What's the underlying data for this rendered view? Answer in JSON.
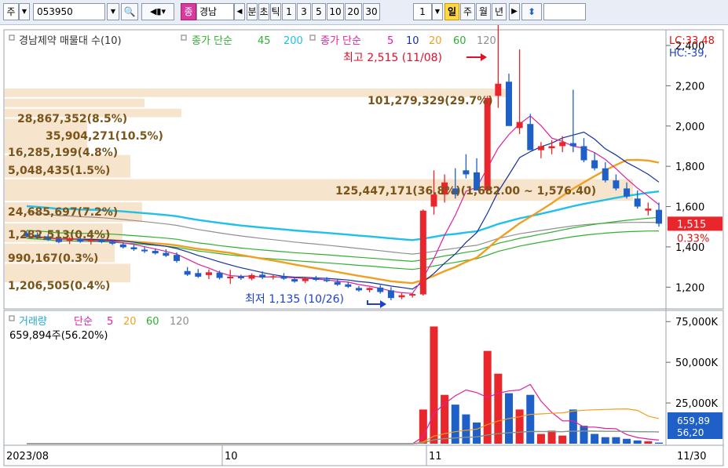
{
  "toolbar": {
    "market": "주",
    "code": "053950",
    "name": "경남",
    "name_badge": "종",
    "periods": [
      "분",
      "초",
      "틱",
      "1",
      "3",
      "5",
      "10",
      "20",
      "30"
    ],
    "count": "1",
    "views": [
      "일",
      "주",
      "월",
      "년"
    ],
    "selected_view": "일"
  },
  "colors": {
    "up": "#e8262b",
    "down": "#1e5fc8",
    "ma5": "#e020a0",
    "ma10": "#1530a0",
    "ma20": "#f0a020",
    "ma60": "#30b030",
    "ma120": "#909090",
    "ma45": "#30b030",
    "ma200": "#20c0ea",
    "volume_band": "#f5e1c8"
  },
  "legend": {
    "title": "경남제약 매물대 수(10)",
    "ma_a_label": "종가 단순",
    "ma_a_periods": [
      "45",
      "200"
    ],
    "ma_b_label": "종가 단순",
    "ma_b_periods": [
      "5",
      "10",
      "20",
      "60",
      "120"
    ],
    "lc": "LC:33,48",
    "hc": "HC:-39,"
  },
  "annotations": {
    "high": "최고 2,515 (11/08)",
    "low": "최저 1,135 (10/26)"
  },
  "volume_profile": [
    {
      "label": "101,279,329(29.7%)"
    },
    {
      "label": "28,867,352(8.5%)"
    },
    {
      "label": "35,904,271(10.5%)"
    },
    {
      "label": "16,285,199(4.8%)"
    },
    {
      "label": "5,048,435(1.5%)"
    },
    {
      "label": "125,447,171(36.8%)(1,682.00 ~ 1,576.40)"
    },
    {
      "label": "24,685,697(7.2%)"
    },
    {
      "label": "1,282,513(0.4%)"
    },
    {
      "label": "990,167(0.3%)"
    },
    {
      "label": "1,206,505(0.4%)"
    }
  ],
  "price_axis": {
    "ticks": [
      "2,400",
      "2,200",
      "2,000",
      "1,800",
      "1,600",
      "1,400",
      "1,200"
    ],
    "current": "1,515",
    "change": "0.33%"
  },
  "volume_panel": {
    "title": "거래량",
    "ma_label": "단순",
    "ma_periods": [
      "5",
      "20",
      "60",
      "120"
    ],
    "info": "659,894주(56.20%)",
    "ticks": [
      "75,000K",
      "50,000K",
      "25,000K"
    ],
    "current": "659,89",
    "current_pct": "56,20"
  },
  "date_axis": {
    "labels": [
      "2023/08",
      "10",
      "11",
      "11/30"
    ]
  },
  "chart_data": {
    "type": "candlestick",
    "price_ylim": [
      1100,
      2470
    ],
    "volume_ylim": [
      0,
      78000000
    ],
    "candles": [
      {
        "o": 1468,
        "h": 1480,
        "l": 1448,
        "c": 1452
      },
      {
        "o": 1460,
        "h": 1472,
        "l": 1440,
        "c": 1446
      },
      {
        "o": 1452,
        "h": 1462,
        "l": 1430,
        "c": 1436
      },
      {
        "o": 1438,
        "h": 1452,
        "l": 1418,
        "c": 1424
      },
      {
        "o": 1430,
        "h": 1448,
        "l": 1414,
        "c": 1440
      },
      {
        "o": 1440,
        "h": 1450,
        "l": 1420,
        "c": 1426
      },
      {
        "o": 1428,
        "h": 1442,
        "l": 1412,
        "c": 1434
      },
      {
        "o": 1434,
        "h": 1440,
        "l": 1418,
        "c": 1424
      },
      {
        "o": 1426,
        "h": 1434,
        "l": 1410,
        "c": 1416
      },
      {
        "o": 1412,
        "h": 1424,
        "l": 1392,
        "c": 1398
      },
      {
        "o": 1398,
        "h": 1410,
        "l": 1380,
        "c": 1388
      },
      {
        "o": 1386,
        "h": 1400,
        "l": 1370,
        "c": 1378
      },
      {
        "o": 1380,
        "h": 1392,
        "l": 1362,
        "c": 1368
      },
      {
        "o": 1370,
        "h": 1388,
        "l": 1350,
        "c": 1356
      },
      {
        "o": 1360,
        "h": 1372,
        "l": 1322,
        "c": 1330
      },
      {
        "o": 1280,
        "h": 1300,
        "l": 1256,
        "c": 1262
      },
      {
        "o": 1270,
        "h": 1290,
        "l": 1246,
        "c": 1252
      },
      {
        "o": 1260,
        "h": 1288,
        "l": 1240,
        "c": 1274
      },
      {
        "o": 1272,
        "h": 1282,
        "l": 1238,
        "c": 1246
      },
      {
        "o": 1244,
        "h": 1286,
        "l": 1216,
        "c": 1252
      },
      {
        "o": 1254,
        "h": 1262,
        "l": 1236,
        "c": 1244
      },
      {
        "o": 1242,
        "h": 1268,
        "l": 1234,
        "c": 1260
      },
      {
        "o": 1262,
        "h": 1278,
        "l": 1240,
        "c": 1248
      },
      {
        "o": 1250,
        "h": 1262,
        "l": 1238,
        "c": 1254
      },
      {
        "o": 1252,
        "h": 1270,
        "l": 1236,
        "c": 1242
      },
      {
        "o": 1240,
        "h": 1250,
        "l": 1222,
        "c": 1228
      },
      {
        "o": 1230,
        "h": 1250,
        "l": 1220,
        "c": 1244
      },
      {
        "o": 1244,
        "h": 1256,
        "l": 1230,
        "c": 1236
      },
      {
        "o": 1238,
        "h": 1250,
        "l": 1224,
        "c": 1230
      },
      {
        "o": 1226,
        "h": 1238,
        "l": 1206,
        "c": 1212
      },
      {
        "o": 1214,
        "h": 1228,
        "l": 1196,
        "c": 1202
      },
      {
        "o": 1196,
        "h": 1206,
        "l": 1178,
        "c": 1184
      },
      {
        "o": 1186,
        "h": 1200,
        "l": 1174,
        "c": 1196
      },
      {
        "o": 1198,
        "h": 1210,
        "l": 1168,
        "c": 1176
      },
      {
        "o": 1184,
        "h": 1200,
        "l": 1135,
        "c": 1146
      },
      {
        "o": 1150,
        "h": 1170,
        "l": 1140,
        "c": 1160
      },
      {
        "o": 1158,
        "h": 1170,
        "l": 1148,
        "c": 1166
      },
      {
        "o": 1164,
        "h": 1586,
        "l": 1158,
        "c": 1580
      },
      {
        "o": 1600,
        "h": 1780,
        "l": 1560,
        "c": 1660
      },
      {
        "o": 1660,
        "h": 1760,
        "l": 1620,
        "c": 1720
      },
      {
        "o": 1690,
        "h": 1790,
        "l": 1640,
        "c": 1660
      },
      {
        "o": 1780,
        "h": 1860,
        "l": 1740,
        "c": 1760
      },
      {
        "o": 1770,
        "h": 1840,
        "l": 1700,
        "c": 1680
      },
      {
        "o": 1680,
        "h": 2150,
        "l": 1670,
        "c": 2140
      },
      {
        "o": 2150,
        "h": 2515,
        "l": 2090,
        "c": 2210
      },
      {
        "o": 2220,
        "h": 2260,
        "l": 2140,
        "c": 2000
      },
      {
        "o": 1990,
        "h": 2380,
        "l": 1960,
        "c": 2020
      },
      {
        "o": 2010,
        "h": 2060,
        "l": 1900,
        "c": 1880
      },
      {
        "o": 1880,
        "h": 1920,
        "l": 1840,
        "c": 1900
      },
      {
        "o": 1890,
        "h": 1930,
        "l": 1860,
        "c": 1900
      },
      {
        "o": 1900,
        "h": 1950,
        "l": 1870,
        "c": 1920
      },
      {
        "o": 1915,
        "h": 2180,
        "l": 1870,
        "c": 1900
      },
      {
        "o": 1900,
        "h": 1940,
        "l": 1820,
        "c": 1830
      },
      {
        "o": 1830,
        "h": 1870,
        "l": 1780,
        "c": 1790
      },
      {
        "o": 1790,
        "h": 1820,
        "l": 1720,
        "c": 1730
      },
      {
        "o": 1730,
        "h": 1760,
        "l": 1680,
        "c": 1690
      },
      {
        "o": 1690,
        "h": 1720,
        "l": 1640,
        "c": 1650
      },
      {
        "o": 1640,
        "h": 1680,
        "l": 1590,
        "c": 1600
      },
      {
        "o": 1580,
        "h": 1620,
        "l": 1556,
        "c": 1590
      },
      {
        "o": 1584,
        "h": 1620,
        "l": 1500,
        "c": 1515
      }
    ],
    "volume": [
      0,
      0,
      0,
      0,
      0,
      0,
      0,
      0,
      0,
      0,
      0,
      0,
      0,
      0,
      0,
      0,
      0,
      0,
      0,
      0,
      0,
      0,
      0,
      0,
      0,
      0,
      0,
      0,
      0,
      0,
      0,
      0,
      0,
      0,
      0,
      0,
      0,
      21000000,
      72000000,
      30000000,
      24000000,
      18000000,
      13000000,
      57000000,
      43000000,
      31000000,
      21000000,
      30000000,
      6000000,
      8000000,
      5000000,
      21000000,
      11000000,
      6000000,
      4000000,
      4000000,
      3000000,
      2000000,
      1500000,
      659894
    ],
    "volume_band_edges": [
      2190,
      2140,
      2090,
      2040,
      1860,
      1740,
      1625,
      1520,
      1420,
      1320,
      1220
    ]
  }
}
